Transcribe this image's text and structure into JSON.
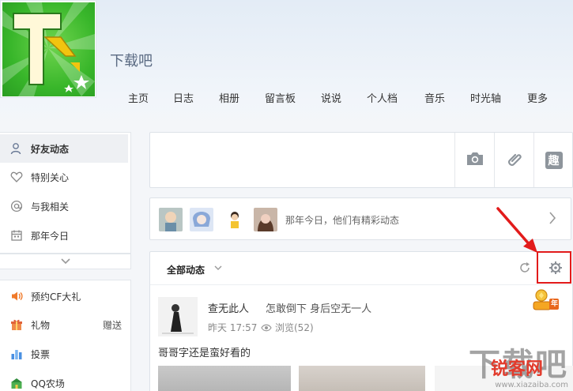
{
  "header": {
    "space_title": "下载吧",
    "nav": [
      {
        "label": "主页"
      },
      {
        "label": "日志"
      },
      {
        "label": "相册"
      },
      {
        "label": "留言板"
      },
      {
        "label": "说说"
      },
      {
        "label": "个人档"
      },
      {
        "label": "音乐"
      },
      {
        "label": "时光轴"
      },
      {
        "label": "更多"
      }
    ]
  },
  "sidebar": {
    "items": [
      {
        "label": "好友动态",
        "icon": "person-icon",
        "active": true
      },
      {
        "label": "特别关心",
        "icon": "heart-icon"
      },
      {
        "label": "与我相关",
        "icon": "at-icon"
      },
      {
        "label": "那年今日",
        "icon": "calendar-icon"
      }
    ],
    "apps": [
      {
        "label": "预约CF大礼",
        "icon": "speaker-icon"
      },
      {
        "label": "礼物",
        "icon": "gift-icon",
        "extra": "赠送"
      },
      {
        "label": "投票",
        "icon": "bar-chart-icon"
      },
      {
        "label": "QQ农场",
        "icon": "farm-icon"
      }
    ]
  },
  "composer": {
    "tools": [
      {
        "name": "camera-icon"
      },
      {
        "name": "link-icon"
      },
      {
        "name": "qu-icon",
        "label": "趣"
      }
    ]
  },
  "today": {
    "text": "那年今日，他们有精彩动态"
  },
  "feed": {
    "tab_label": "全部动态",
    "post": {
      "user": "查无此人",
      "text": "怎敢倒下 身后空无一人",
      "time": "昨天 17:57",
      "views": "浏览(52)",
      "body": "哥哥字还是蛮好看的"
    },
    "badge": "年"
  },
  "watermark": {
    "big": "下载吧",
    "mid": "锐客网",
    "small": "www.xiazaiba.com"
  },
  "colors": {
    "highlight": "#e21b1b",
    "logo_green": "#38b62a"
  }
}
